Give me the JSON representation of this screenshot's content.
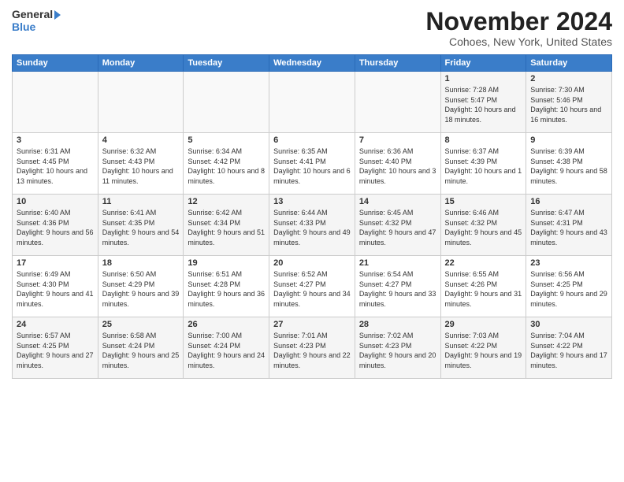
{
  "header": {
    "logo_general": "General",
    "logo_blue": "Blue",
    "month_title": "November 2024",
    "location": "Cohoes, New York, United States"
  },
  "weekdays": [
    "Sunday",
    "Monday",
    "Tuesday",
    "Wednesday",
    "Thursday",
    "Friday",
    "Saturday"
  ],
  "weeks": [
    [
      {
        "day": "",
        "info": ""
      },
      {
        "day": "",
        "info": ""
      },
      {
        "day": "",
        "info": ""
      },
      {
        "day": "",
        "info": ""
      },
      {
        "day": "",
        "info": ""
      },
      {
        "day": "1",
        "info": "Sunrise: 7:28 AM\nSunset: 5:47 PM\nDaylight: 10 hours and 18 minutes."
      },
      {
        "day": "2",
        "info": "Sunrise: 7:30 AM\nSunset: 5:46 PM\nDaylight: 10 hours and 16 minutes."
      }
    ],
    [
      {
        "day": "3",
        "info": "Sunrise: 6:31 AM\nSunset: 4:45 PM\nDaylight: 10 hours and 13 minutes."
      },
      {
        "day": "4",
        "info": "Sunrise: 6:32 AM\nSunset: 4:43 PM\nDaylight: 10 hours and 11 minutes."
      },
      {
        "day": "5",
        "info": "Sunrise: 6:34 AM\nSunset: 4:42 PM\nDaylight: 10 hours and 8 minutes."
      },
      {
        "day": "6",
        "info": "Sunrise: 6:35 AM\nSunset: 4:41 PM\nDaylight: 10 hours and 6 minutes."
      },
      {
        "day": "7",
        "info": "Sunrise: 6:36 AM\nSunset: 4:40 PM\nDaylight: 10 hours and 3 minutes."
      },
      {
        "day": "8",
        "info": "Sunrise: 6:37 AM\nSunset: 4:39 PM\nDaylight: 10 hours and 1 minute."
      },
      {
        "day": "9",
        "info": "Sunrise: 6:39 AM\nSunset: 4:38 PM\nDaylight: 9 hours and 58 minutes."
      }
    ],
    [
      {
        "day": "10",
        "info": "Sunrise: 6:40 AM\nSunset: 4:36 PM\nDaylight: 9 hours and 56 minutes."
      },
      {
        "day": "11",
        "info": "Sunrise: 6:41 AM\nSunset: 4:35 PM\nDaylight: 9 hours and 54 minutes."
      },
      {
        "day": "12",
        "info": "Sunrise: 6:42 AM\nSunset: 4:34 PM\nDaylight: 9 hours and 51 minutes."
      },
      {
        "day": "13",
        "info": "Sunrise: 6:44 AM\nSunset: 4:33 PM\nDaylight: 9 hours and 49 minutes."
      },
      {
        "day": "14",
        "info": "Sunrise: 6:45 AM\nSunset: 4:32 PM\nDaylight: 9 hours and 47 minutes."
      },
      {
        "day": "15",
        "info": "Sunrise: 6:46 AM\nSunset: 4:32 PM\nDaylight: 9 hours and 45 minutes."
      },
      {
        "day": "16",
        "info": "Sunrise: 6:47 AM\nSunset: 4:31 PM\nDaylight: 9 hours and 43 minutes."
      }
    ],
    [
      {
        "day": "17",
        "info": "Sunrise: 6:49 AM\nSunset: 4:30 PM\nDaylight: 9 hours and 41 minutes."
      },
      {
        "day": "18",
        "info": "Sunrise: 6:50 AM\nSunset: 4:29 PM\nDaylight: 9 hours and 39 minutes."
      },
      {
        "day": "19",
        "info": "Sunrise: 6:51 AM\nSunset: 4:28 PM\nDaylight: 9 hours and 36 minutes."
      },
      {
        "day": "20",
        "info": "Sunrise: 6:52 AM\nSunset: 4:27 PM\nDaylight: 9 hours and 34 minutes."
      },
      {
        "day": "21",
        "info": "Sunrise: 6:54 AM\nSunset: 4:27 PM\nDaylight: 9 hours and 33 minutes."
      },
      {
        "day": "22",
        "info": "Sunrise: 6:55 AM\nSunset: 4:26 PM\nDaylight: 9 hours and 31 minutes."
      },
      {
        "day": "23",
        "info": "Sunrise: 6:56 AM\nSunset: 4:25 PM\nDaylight: 9 hours and 29 minutes."
      }
    ],
    [
      {
        "day": "24",
        "info": "Sunrise: 6:57 AM\nSunset: 4:25 PM\nDaylight: 9 hours and 27 minutes."
      },
      {
        "day": "25",
        "info": "Sunrise: 6:58 AM\nSunset: 4:24 PM\nDaylight: 9 hours and 25 minutes."
      },
      {
        "day": "26",
        "info": "Sunrise: 7:00 AM\nSunset: 4:24 PM\nDaylight: 9 hours and 24 minutes."
      },
      {
        "day": "27",
        "info": "Sunrise: 7:01 AM\nSunset: 4:23 PM\nDaylight: 9 hours and 22 minutes."
      },
      {
        "day": "28",
        "info": "Sunrise: 7:02 AM\nSunset: 4:23 PM\nDaylight: 9 hours and 20 minutes."
      },
      {
        "day": "29",
        "info": "Sunrise: 7:03 AM\nSunset: 4:22 PM\nDaylight: 9 hours and 19 minutes."
      },
      {
        "day": "30",
        "info": "Sunrise: 7:04 AM\nSunset: 4:22 PM\nDaylight: 9 hours and 17 minutes."
      }
    ]
  ]
}
